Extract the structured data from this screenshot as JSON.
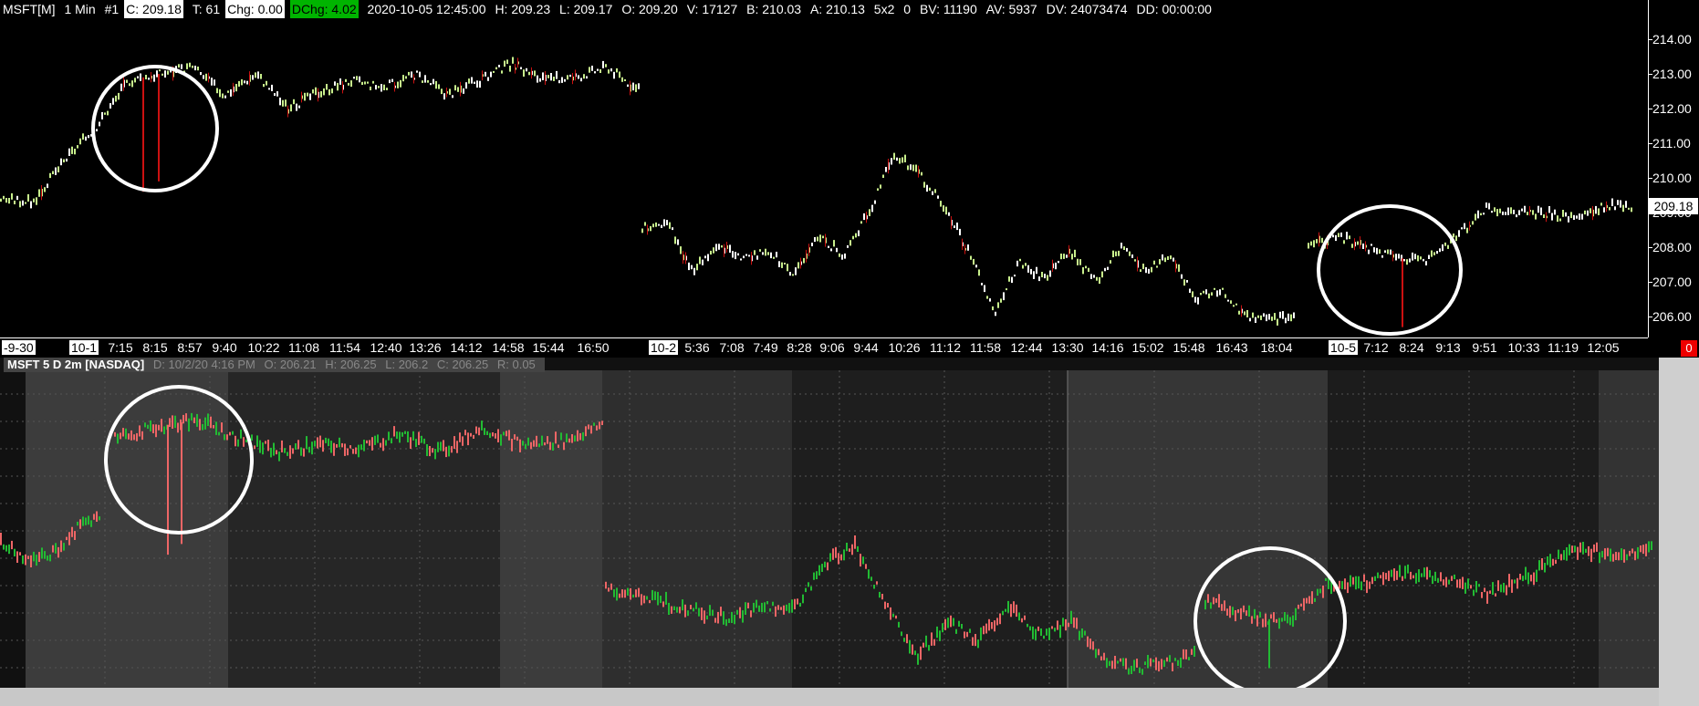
{
  "top_header": {
    "symbol": "MSFT[M]",
    "interval": "1 Min",
    "number": "#1",
    "close": "C: 209.18",
    "ticks": "T: 61",
    "chg": "Chg: 0.00",
    "dchg": "DChg: 4.02",
    "datetime": "2020-10-05 12:45:00",
    "high": "H: 209.23",
    "low": "L: 209.17",
    "open": "O: 209.20",
    "volume": "V: 17127",
    "bid": "B: 210.03",
    "ask": "A: 210.13",
    "size": "5x2",
    "zero": "0",
    "bv": "BV: 11190",
    "av": "AV: 5937",
    "dv": "DV: 24073474",
    "dd": "DD: 00:00:00"
  },
  "price_axis": {
    "labels": [
      "214.00",
      "213.00",
      "212.00",
      "211.00",
      "210.00",
      "209.00",
      "208.00",
      "207.00",
      "206.00"
    ],
    "last_price": "209.18"
  },
  "time_axis": {
    "labels": [
      "-9-30",
      "10-1",
      "7:15",
      "8:15",
      "8:57",
      "9:40",
      "10:22",
      "11:08",
      "11:54",
      "12:40",
      "13:26",
      "14:12",
      "14:58",
      "15:44",
      "16:50",
      "10-2",
      "5:36",
      "7:08",
      "7:49",
      "8:28",
      "9:06",
      "9:44",
      "10:26",
      "11:12",
      "11:58",
      "12:44",
      "13:30",
      "14:16",
      "15:02",
      "15:48",
      "16:43",
      "18:04",
      "10-5",
      "7:12",
      "8:24",
      "9:13",
      "9:51",
      "10:33",
      "11:19",
      "12:05"
    ],
    "badge": "0"
  },
  "bottom_header": {
    "symbol": "MSFT 5 D 2m [NASDAQ]",
    "date": "D: 10/2/20 4:16 PM",
    "open": "O: 206.21",
    "high": "H: 206.25",
    "low": "L: 206.2",
    "close": "C: 206.25",
    "range": "R: 0.05"
  },
  "colors": {
    "top_candle": "#c8f08c",
    "top_wick_down": "#cc1111",
    "bottom_up": "#22bb33",
    "bottom_down": "#ee6666",
    "annotation_circle": "#ffffff"
  },
  "chart_data": [
    {
      "type": "candlestick",
      "title": "MSFT[M] 1 Min",
      "ylim": [
        205.5,
        214.5
      ],
      "y_ticks": [
        206,
        207,
        208,
        209,
        210,
        211,
        212,
        213,
        214
      ],
      "segments": [
        {
          "session": "10-1",
          "anchor_prices": [
            209.4,
            209.3,
            210.5,
            211.5,
            212.8,
            213.0,
            213.2,
            212.4,
            213.0,
            212.0,
            212.5,
            212.8,
            212.6,
            213.0,
            212.4,
            212.8,
            213.3,
            212.8,
            212.9,
            213.2,
            212.5
          ]
        },
        {
          "session": "10-2",
          "anchor_prices": [
            208.6,
            208.7,
            207.3,
            208.0,
            207.7,
            207.9,
            207.2,
            208.3,
            207.8,
            209.0,
            210.7,
            210.1,
            209.2,
            207.8,
            206.1,
            207.6,
            207.1,
            207.9,
            207.0,
            208.0,
            207.3,
            207.8,
            206.5,
            206.8,
            206.0,
            205.9,
            206.0
          ]
        },
        {
          "session": "10-5",
          "anchor_prices": [
            208.0,
            208.3,
            208.0,
            207.7,
            207.6,
            208.3,
            209.1,
            209.0,
            209.0,
            208.8,
            209.2,
            209.2
          ]
        }
      ],
      "spikes": [
        {
          "session": "10-1",
          "low": 209.6
        },
        {
          "session": "10-1",
          "low": 209.9
        },
        {
          "session": "10-5",
          "low": 205.7
        }
      ]
    },
    {
      "type": "candlestick",
      "title": "MSFT 5 D 2m [NASDAQ]",
      "ylim": [
        205.5,
        214.5
      ],
      "segments": [
        {
          "session": "9-30",
          "anchor_prices": [
            209.6,
            209.0,
            209.2,
            209.9,
            210.4
          ]
        },
        {
          "session": "10-1",
          "anchor_prices": [
            212.5,
            212.8,
            213.0,
            212.5,
            212.1,
            212.3,
            212.2,
            212.6,
            212.1,
            212.8,
            212.3,
            212.4,
            212.9
          ]
        },
        {
          "session": "10-2",
          "anchor_prices": [
            208.2,
            208.1,
            207.8,
            207.6,
            207.4,
            207.8,
            207.6,
            208.9,
            209.5,
            207.8,
            206.3,
            207.3,
            206.8,
            207.7,
            206.9,
            207.3,
            206.3,
            206.0,
            206.1,
            206.4
          ]
        },
        {
          "session": "10-5",
          "anchor_prices": [
            207.9,
            207.5,
            207.3,
            208.4,
            208.4,
            208.7,
            208.5,
            208.1,
            208.6,
            209.4,
            209.2,
            209.4
          ]
        }
      ],
      "spikes": [
        {
          "session": "10-1",
          "low": 209.2
        },
        {
          "session": "10-1",
          "low": 209.5
        },
        {
          "session": "10-5",
          "low": 206.0
        }
      ]
    }
  ]
}
